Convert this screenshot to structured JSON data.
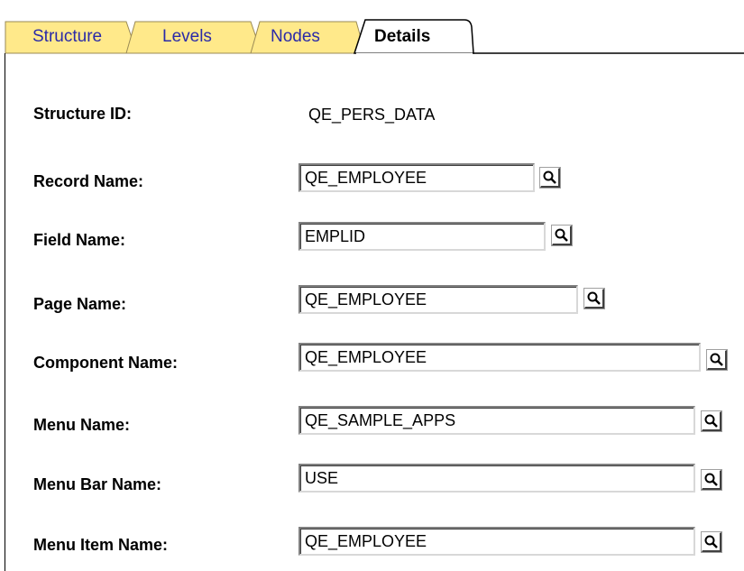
{
  "tabs": [
    {
      "label": "Structure",
      "active": false
    },
    {
      "label": "Levels",
      "active": false
    },
    {
      "label": "Nodes",
      "active": false
    },
    {
      "label": "Details",
      "active": true
    }
  ],
  "colors": {
    "inactive_tab_fill": "#ffe98a",
    "inactive_tab_text": "#2a2aa8",
    "active_tab_fill": "#ffffff"
  },
  "structure_id": {
    "label": "Structure ID:",
    "value": "QE_PERS_DATA"
  },
  "fields": {
    "record_name": {
      "label": "Record Name:",
      "value": "QE_EMPLOYEE",
      "lookup_icon": "magnifier-icon"
    },
    "field_name": {
      "label": "Field Name:",
      "value": "EMPLID",
      "lookup_icon": "magnifier-icon"
    },
    "page_name": {
      "label": "Page Name:",
      "value": "QE_EMPLOYEE",
      "lookup_icon": "magnifier-icon"
    },
    "component_name": {
      "label": "Component Name:",
      "value": "QE_EMPLOYEE",
      "lookup_icon": "magnifier-icon"
    },
    "menu_name": {
      "label": "Menu Name:",
      "value": "QE_SAMPLE_APPS",
      "lookup_icon": "magnifier-icon"
    },
    "menu_bar_name": {
      "label": "Menu Bar Name:",
      "value": "USE",
      "lookup_icon": "magnifier-icon"
    },
    "menu_item_name": {
      "label": "Menu Item Name:",
      "value": "QE_EMPLOYEE",
      "lookup_icon": "magnifier-icon"
    }
  }
}
